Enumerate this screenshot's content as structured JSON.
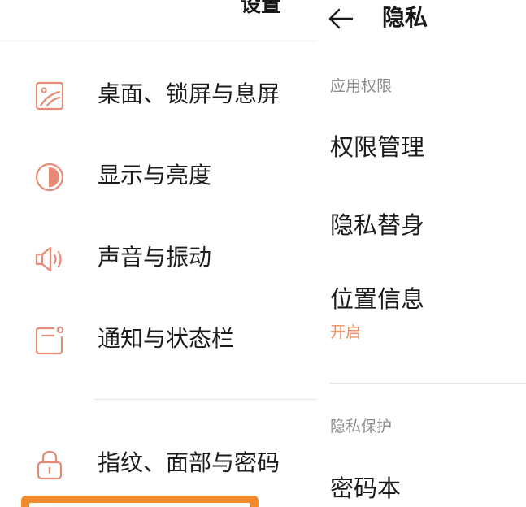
{
  "settings": {
    "title": "设置",
    "items": [
      {
        "label": "桌面、锁屏与息屏",
        "icon": "wallpaper-icon"
      },
      {
        "label": "显示与亮度",
        "icon": "brightness-icon"
      },
      {
        "label": "声音与振动",
        "icon": "speaker-icon"
      },
      {
        "label": "通知与状态栏",
        "icon": "notification-icon"
      },
      {
        "label": "指纹、面部与密码",
        "icon": "lock-icon"
      }
    ]
  },
  "privacy": {
    "title": "隐私",
    "sections": [
      {
        "header": "应用权限",
        "items": [
          {
            "label": "权限管理"
          },
          {
            "label": "隐私替身"
          },
          {
            "label": "位置信息",
            "status": "开启"
          }
        ]
      },
      {
        "header": "隐私保护",
        "items": [
          {
            "label": "密码本"
          }
        ]
      }
    ]
  },
  "colors": {
    "accent": "#e58a77",
    "status_on": "#ef8a5c",
    "highlight_frame": "#f08a2c",
    "text_primary": "#1c1c1c",
    "text_secondary": "#8c8c8c"
  }
}
